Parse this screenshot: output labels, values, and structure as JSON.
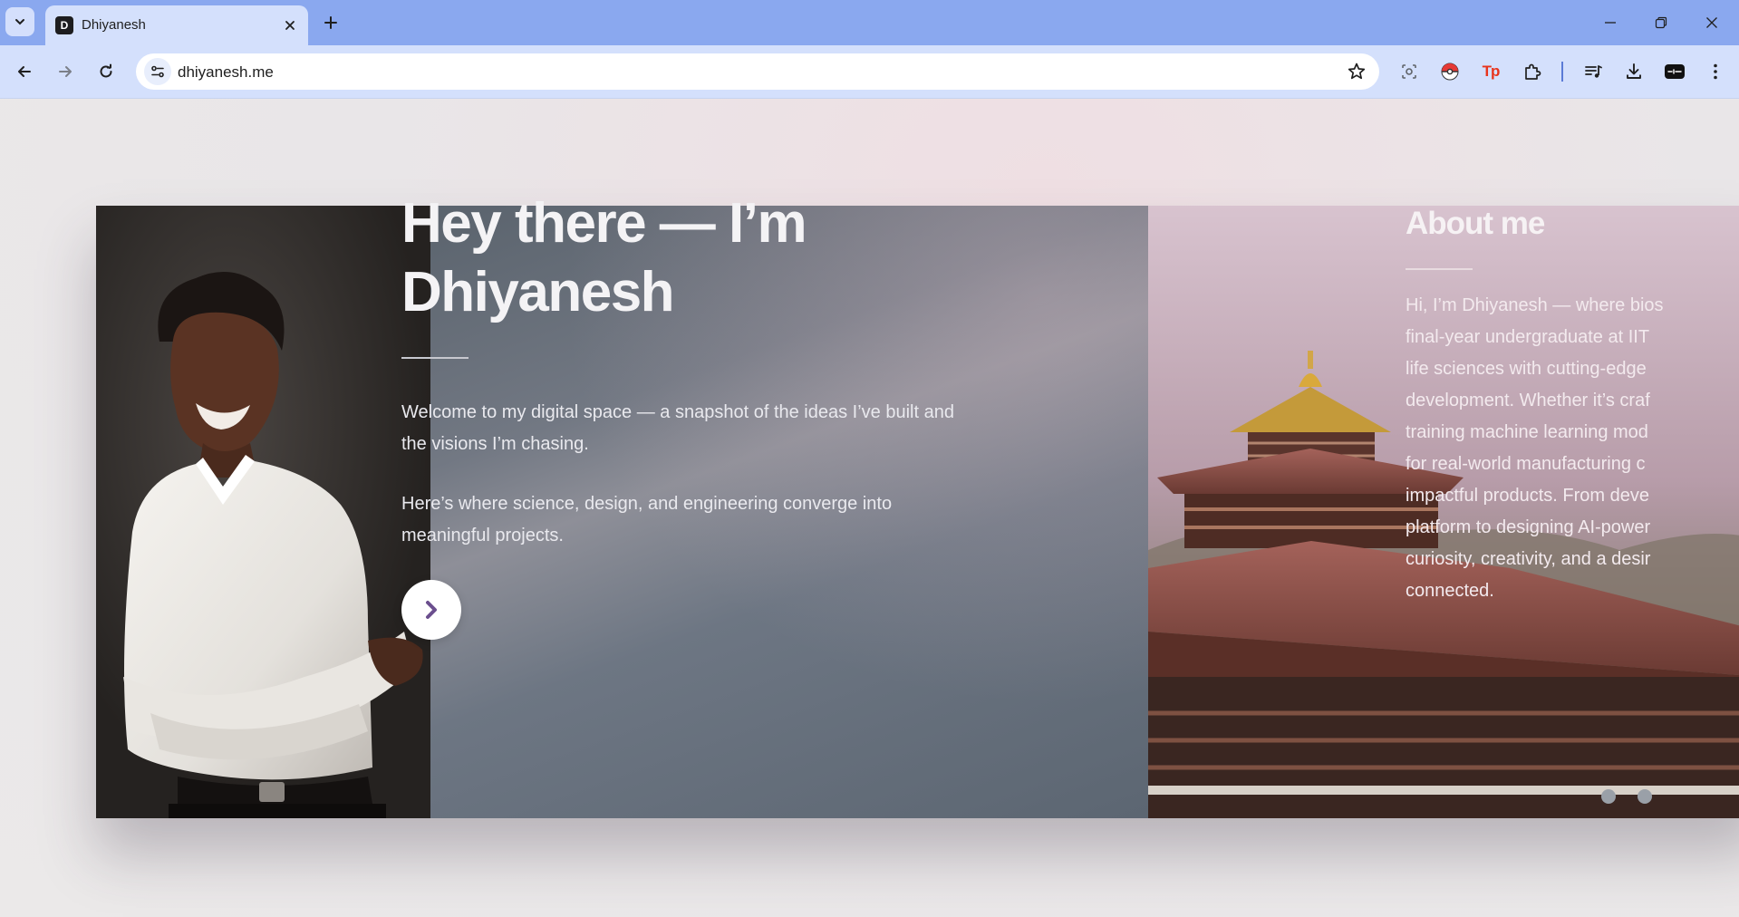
{
  "browser": {
    "tab": {
      "title": "Dhiyanesh",
      "favicon_letter": "D"
    },
    "address_bar": {
      "url": "dhiyanesh.me"
    },
    "icons": [
      "tab-search-icon",
      "close-icon",
      "plus-icon",
      "minimize-icon",
      "restore-icon",
      "back-icon",
      "forward-icon",
      "reload-icon",
      "site-info-icon",
      "star-icon",
      "lens-icon",
      "pokeball-extension-icon",
      "tp-extension-icon",
      "puzzle-icon",
      "media-icon",
      "download-icon",
      "profile-icon",
      "kebab-menu-icon"
    ],
    "extensions": {
      "tp_label": "Tp",
      "profile_label": "ðŸŽµ"
    }
  },
  "hero": {
    "title_line1": "Hey there — I’m",
    "title_line2": "Dhiyanesh",
    "paragraph1": "Welcome to my digital space — a snapshot of the ideas I’ve built and the visions I’m chasing.",
    "paragraph2": "Here’s where science, design, and engineering converge into meaningful projects.",
    "cta_icon": "chevron-right-icon"
  },
  "about": {
    "title": "About me",
    "lines": [
      "Hi, I’m Dhiyanesh — where bios",
      "final-year undergraduate at IIT",
      "life sciences with cutting-edge",
      "development. Whether it’s craf",
      "training machine learning mod",
      "for real-world manufacturing c",
      "impactful products. From deve",
      "platform to designing AI-power",
      "curiosity, creativity, and a desir",
      "connected."
    ]
  },
  "colors": {
    "tabstrip": "#8aa8ef",
    "toolbar": "#d4e0fc",
    "cta_chevron": "#6b4f8e"
  }
}
